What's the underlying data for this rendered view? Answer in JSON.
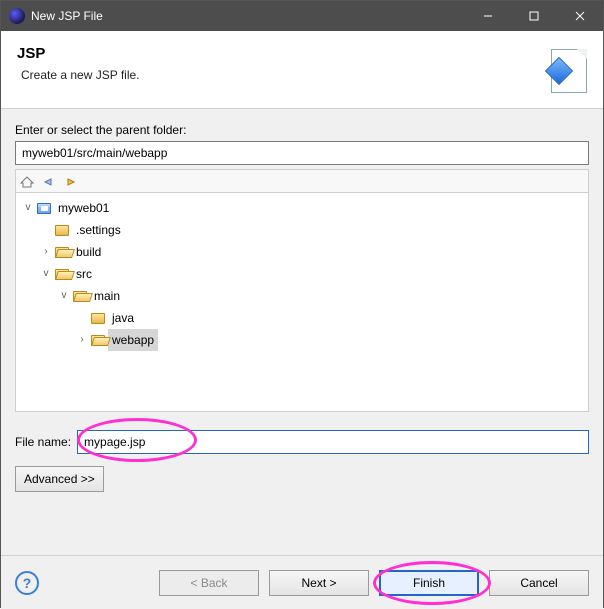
{
  "window": {
    "title": "New JSP File"
  },
  "banner": {
    "heading": "JSP",
    "subtitle": "Create a new JSP file."
  },
  "parent": {
    "label": "Enter or select the parent folder:",
    "value": "myweb01/src/main/webapp"
  },
  "tree": {
    "root": {
      "name": "myweb01",
      "children": {
        "settings": {
          "name": ".settings"
        },
        "build": {
          "name": "build"
        },
        "src": {
          "name": "src",
          "main": {
            "name": "main",
            "java": {
              "name": "java"
            },
            "webapp": {
              "name": "webapp"
            }
          }
        }
      }
    }
  },
  "file": {
    "label": "File name:",
    "value": "mypage.jsp"
  },
  "buttons": {
    "advanced": "Advanced >>",
    "back": "< Back",
    "next": "Next >",
    "finish": "Finish",
    "cancel": "Cancel"
  }
}
